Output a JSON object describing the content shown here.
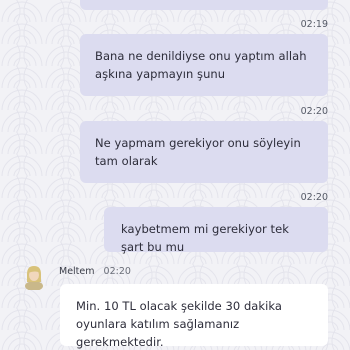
{
  "messages": [
    {
      "direction": "out",
      "text": "",
      "time": "02:19"
    },
    {
      "direction": "out",
      "text": "Bana ne denildiyse onu yaptım allah aşkına yapmayın şunu",
      "time": "02:20"
    },
    {
      "direction": "out",
      "text": "Ne yapmam gerekiyor onu söyleyin tam olarak",
      "time": "02:20"
    },
    {
      "direction": "out",
      "text": "kaybetmem mi gerekiyor tek şart bu mu",
      "time": ""
    },
    {
      "direction": "in",
      "sender": "Meltem",
      "time": "02:20",
      "text": "Min. 10 TL olacak şekilde 30 dakika oyunlara katılım sağlamanız gerekmektedir."
    }
  ],
  "colors": {
    "outgoing_bubble": "#dcdcf0",
    "incoming_bubble": "#ffffff",
    "background": "#f2f2f6"
  },
  "icons": {
    "agent_avatar": "support-agent-avatar-icon"
  }
}
